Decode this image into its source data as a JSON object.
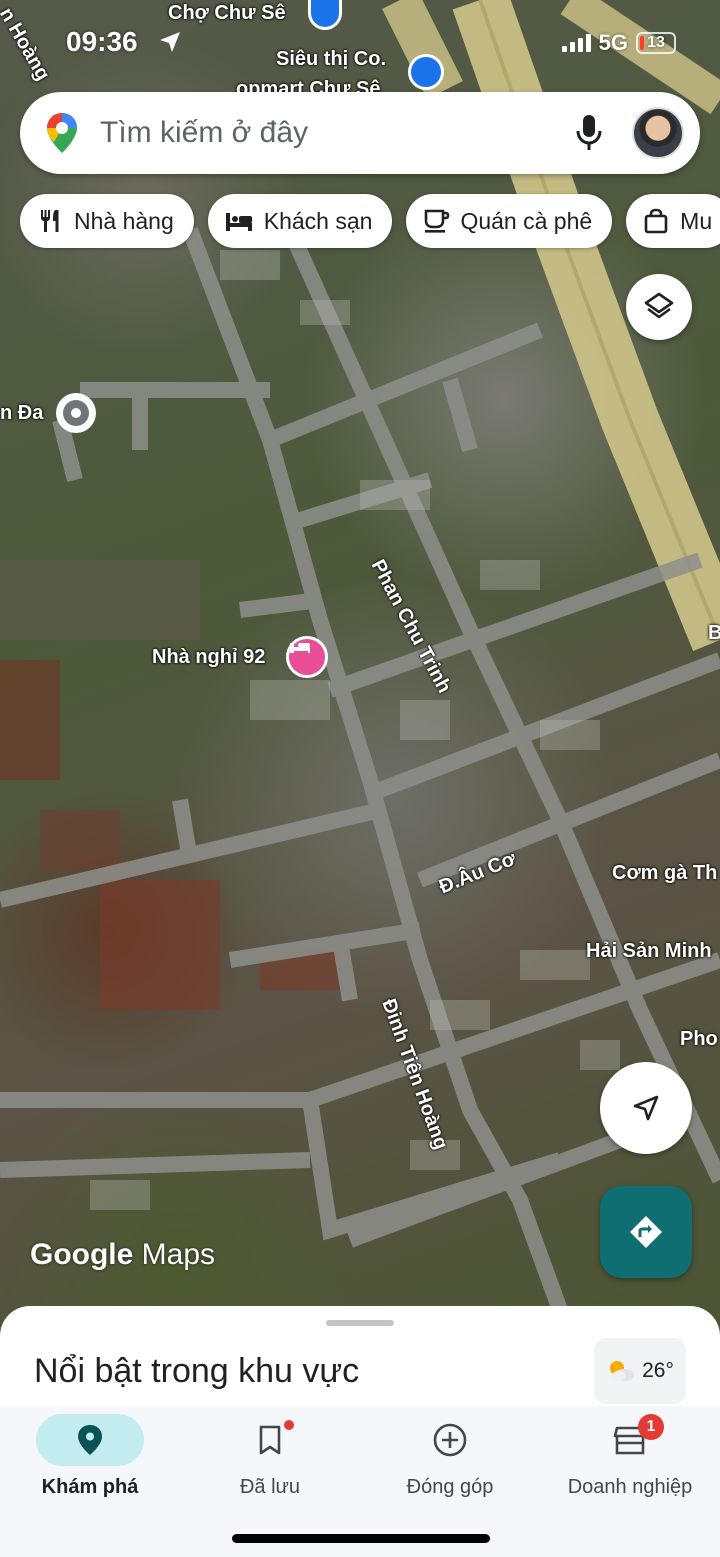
{
  "status": {
    "time": "09:36",
    "network": "5G",
    "battery": "13"
  },
  "search": {
    "placeholder": "Tìm kiếm ở đây"
  },
  "chips": [
    {
      "label": "Nhà hàng",
      "icon": "restaurant-icon"
    },
    {
      "label": "Khách sạn",
      "icon": "hotel-icon"
    },
    {
      "label": "Quán cà phê",
      "icon": "coffee-icon"
    },
    {
      "label": "Mu",
      "icon": "shopping-icon"
    }
  ],
  "map": {
    "roads": [
      "Phan Chu Trinh",
      "Đ.Âu Cơ",
      "Đinh Tiên Hoàng",
      "n Hoàng"
    ],
    "places": [
      "Chợ Chư Sê",
      "Siêu thị Co.",
      "opmart Chư Sê",
      "Nhà nghỉ 92",
      "Cơm gà Th",
      "Hải Sản Minh",
      "Pho",
      "n Đa",
      "B"
    ],
    "brand": {
      "bold": "Google",
      "rest": " Maps"
    }
  },
  "sheet": {
    "title": "Nổi bật trong khu vực",
    "temperature": "26°"
  },
  "nav": [
    {
      "label": "Khám phá",
      "active": true
    },
    {
      "label": "Đã lưu",
      "active": false
    },
    {
      "label": "Đóng góp",
      "active": false
    },
    {
      "label": "Doanh nghiệp",
      "active": false,
      "badge": "1"
    }
  ],
  "colors": {
    "accent": "#0f6e72",
    "nav_active_bg": "#c3ecf0",
    "hotel_pin": "#e84e95",
    "shop_pin": "#1a73e8"
  }
}
